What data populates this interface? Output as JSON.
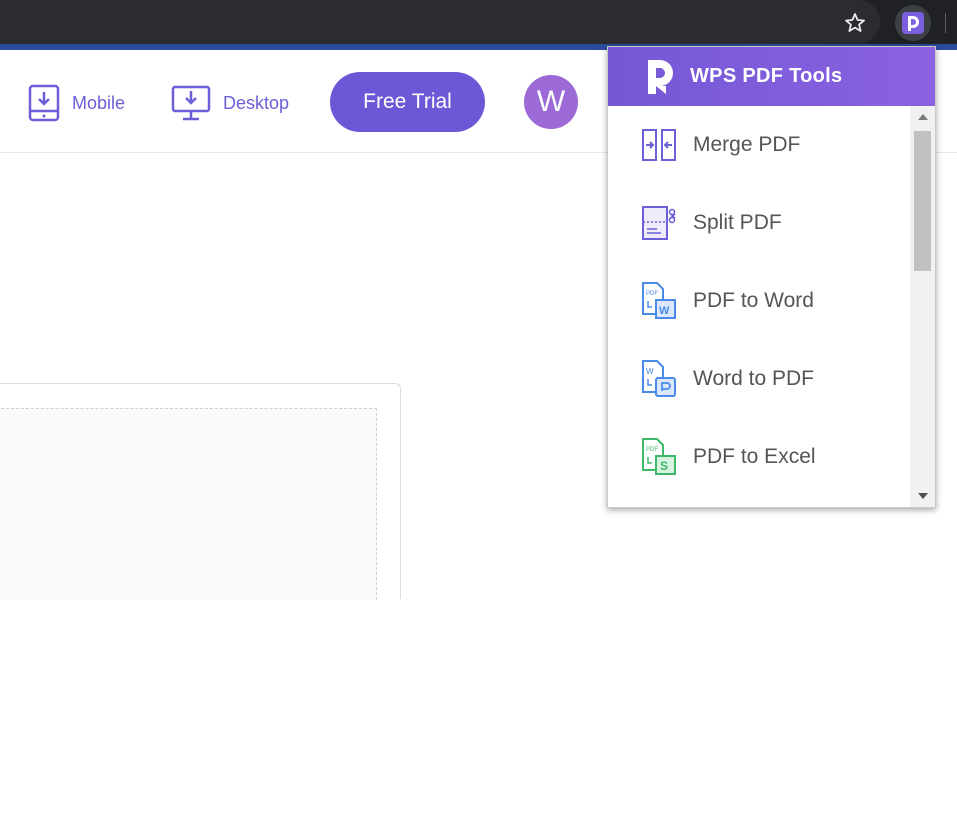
{
  "browser": {
    "toolbar_icons": [
      "bookmark-star-icon",
      "wps-pdf-extension-icon"
    ]
  },
  "header": {
    "nav": [
      {
        "label": "Mobile",
        "icon": "mobile-download-icon"
      },
      {
        "label": "Desktop",
        "icon": "desktop-download-icon"
      }
    ],
    "trial_label": "Free Trial",
    "avatar_initial": "W"
  },
  "popup": {
    "title": "WPS PDF Tools",
    "tools": [
      {
        "label": "Merge PDF",
        "icon": "merge-pdf-icon"
      },
      {
        "label": "Split PDF",
        "icon": "split-pdf-icon"
      },
      {
        "label": "PDF to Word",
        "icon": "pdf-to-word-icon"
      },
      {
        "label": "Word to PDF",
        "icon": "word-to-pdf-icon"
      },
      {
        "label": "PDF to Excel",
        "icon": "pdf-to-excel-icon"
      }
    ]
  },
  "colors": {
    "brand": "#6c58d6",
    "popup_header": "#7458d6",
    "avatar": "#9b6ad6",
    "browser_dark": "#202124"
  }
}
